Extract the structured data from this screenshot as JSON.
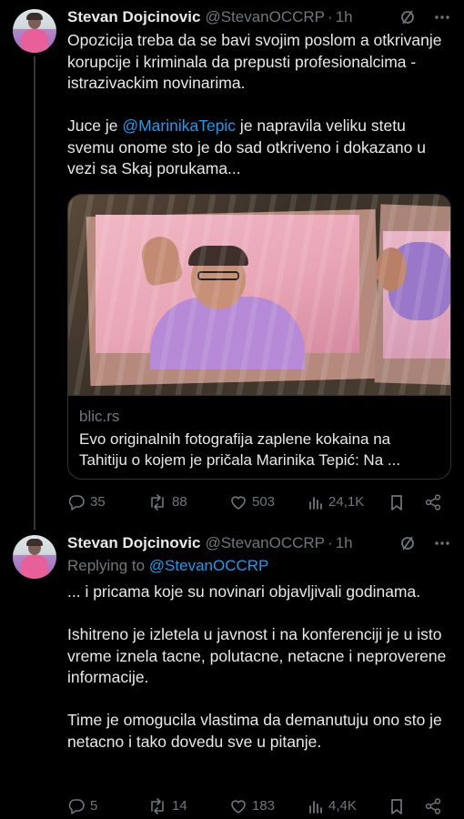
{
  "tweets": [
    {
      "author_name": "Stevan Dojcinovic",
      "handle": "@StevanOCCRP",
      "separator": "·",
      "time": "1h",
      "paragraphs": [
        {
          "parts": [
            {
              "text": "Opozicija treba da se bavi svojim poslom a otkrivanje korupcije i kriminala da prepusti profesionalcima - istrazivackim novinarima."
            }
          ]
        },
        {
          "parts": [
            {
              "text": "Juce je "
            },
            {
              "text": "@MarinikaTepic",
              "mention": true
            },
            {
              "text": " je napravila veliku stetu svemu onome sto je do sad otkriveno i dokazano u vezi sa Skaj porukama..."
            }
          ]
        }
      ],
      "card": {
        "domain": "blic.rs",
        "title": "Evo originalnih fotografija zaplene kokaina na Tahitiju o kojem je pričala Marinika Tepić: Na ..."
      },
      "actions": {
        "replies": "35",
        "reposts": "88",
        "likes": "503",
        "views": "24,1K"
      }
    },
    {
      "author_name": "Stevan Dojcinovic",
      "handle": "@StevanOCCRP",
      "separator": "·",
      "time": "1h",
      "replying_to_label": "Replying to",
      "replying_to_handle": "@StevanOCCRP",
      "paragraphs": [
        {
          "parts": [
            {
              "text": "... i pricama koje su novinari objavljivali godinama."
            }
          ]
        },
        {
          "parts": [
            {
              "text": "Ishitreno je izletela u javnost i na konferenciji je u isto vreme iznela tacne, polutacne, netacne i neproverene informacije."
            }
          ]
        },
        {
          "parts": [
            {
              "text": "Time je omogucila vlastima da demanutuju ono sto je netacno i tako dovedu sve u pitanje."
            }
          ]
        }
      ],
      "actions": {
        "replies": "5",
        "reposts": "14",
        "likes": "183",
        "views": "4,4K"
      }
    }
  ],
  "icons": {
    "reply": "reply-icon",
    "repost": "repost-icon",
    "like": "like-icon",
    "views": "views-icon",
    "bookmark": "bookmark-icon",
    "share": "share-icon",
    "grok": "grok-icon",
    "more": "more-icon"
  },
  "colors": {
    "background": "#000000",
    "text": "#e7e9ea",
    "muted": "#71767b",
    "accent": "#1d9bf0",
    "border": "#2f3336"
  }
}
